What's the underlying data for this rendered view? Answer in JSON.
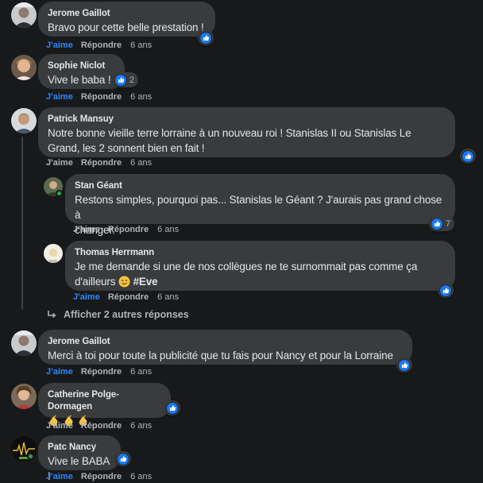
{
  "actions": {
    "like": "J'aime",
    "reply": "Répondre"
  },
  "comments": [
    {
      "author": "Jerome Gaillot",
      "text": "Bravo pour cette belle prestation !",
      "time": "6 ans",
      "likes": ""
    },
    {
      "author": "Sophie Niclot",
      "text": "Vive le baba !",
      "time": "6 ans",
      "likes": "2"
    },
    {
      "author": "Patrick Mansuy",
      "text_line1": "Notre bonne vieille terre lorraine à un nouveau roi ! Stanislas II ou Stanislas Le",
      "text_line2": "Grand, les 2 sonnent bien en fait !",
      "time": "6 ans",
      "likes": ""
    },
    {
      "author": "Stan Géant",
      "text_line1": "Restons simples, pourquoi pas... Stanislas le Géant ? J'aurais pas grand chose à",
      "text_line2": "changer.",
      "time": "6 ans",
      "likes": "7"
    },
    {
      "author": "Thomas Herrmann",
      "text_line1": "Je me demande si une de nos collègues ne te surnommait pas comme ça",
      "text_line2": "d'ailleurs",
      "tag": "#Eve",
      "time": "6 ans",
      "likes": ""
    },
    {
      "author": "Jerome Gaillot",
      "text": "Merci à toi pour toute la publicité que tu fais pour Nancy et pour la Lorraine",
      "time": "6 ans",
      "likes": ""
    },
    {
      "author": "Catherine Polge-Dormagen",
      "text": "",
      "emoji_icon": "clapping-hands-icon",
      "time": "6 ans",
      "likes": ""
    },
    {
      "author": "Patc Nancy",
      "text": "Vive le BABA !",
      "time": "6 ans",
      "likes": ""
    }
  ],
  "more_replies": "Afficher 2 autres réponses",
  "colors": {
    "background": "#18191a",
    "bubble": "#3a3b3c",
    "text": "#e4e6eb",
    "secondary": "#b0b3b8",
    "link": "#2d88ff",
    "like": "#1877f2",
    "online": "#31a24c"
  }
}
